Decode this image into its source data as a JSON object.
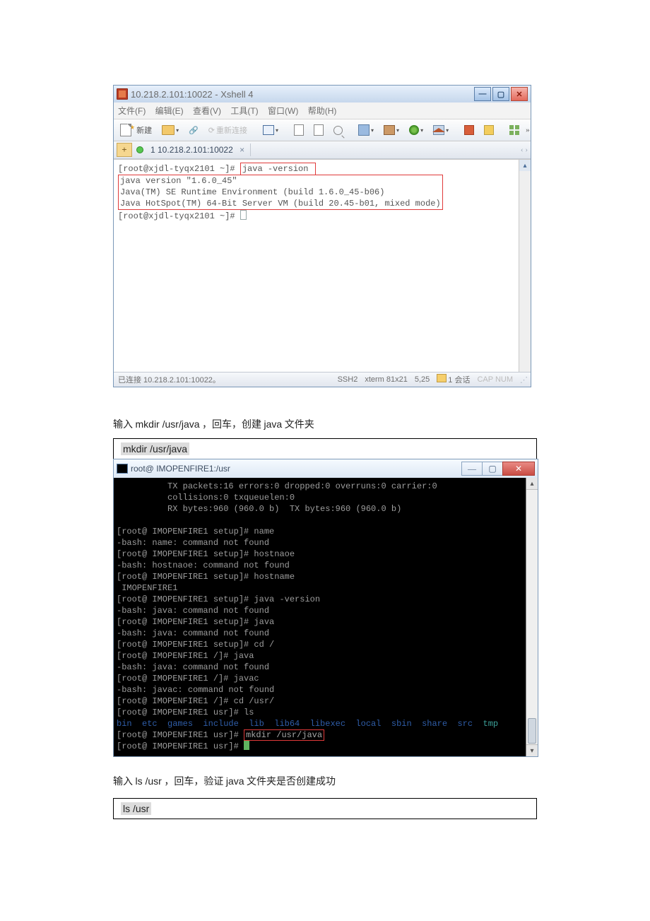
{
  "xshell": {
    "title": "10.218.2.101:10022 - Xshell 4",
    "menus": [
      "文件(F)",
      "编辑(E)",
      "查看(V)",
      "工具(T)",
      "窗口(W)",
      "帮助(H)"
    ],
    "toolbar": {
      "new_label": "新建",
      "reconnect_label": "重新连接"
    },
    "tab": {
      "label": "1 10.218.2.101:10022"
    },
    "terminal": {
      "prompt1": "[root@xjdl-tyqx2101 ~]#",
      "cmd1": "java -version",
      "out": [
        "java version \"1.6.0_45\"",
        "Java(TM) SE Runtime Environment (build 1.6.0_45-b06)",
        "Java HotSpot(TM) 64-Bit Server VM (build 20.45-b01, mixed mode)"
      ],
      "prompt2": "[root@xjdl-tyqx2101 ~]#"
    },
    "status": {
      "left": "已连接 10.218.2.101:10022。",
      "ssh": "SSH2",
      "term": "xterm  81x21",
      "pos": "5,25",
      "sess": "1 会话",
      "caps": "CAP  NUM"
    }
  },
  "text1_pre": "输入 ",
  "text1_cmd": "mkdir /usr/java",
  "text1_mid": "   ，回车，创建  ",
  "text1_j": "java",
  "text1_post": " 文件夹",
  "cmd1": "mkdir /usr/java",
  "darkwin": {
    "title": "root@ IMOPENFIRE1:/usr",
    "lines_top": [
      "          TX packets:16 errors:0 dropped:0 overruns:0 carrier:0",
      "          collisions:0 txqueuelen:0",
      "          RX bytes:960 (960.0 b)  TX bytes:960 (960.0 b)",
      ""
    ],
    "lines": [
      "[root@ IMOPENFIRE1 setup]# name",
      "-bash: name: command not found",
      "[root@ IMOPENFIRE1 setup]# hostnaoe",
      "-bash: hostnaoe: command not found",
      "[root@ IMOPENFIRE1 setup]# hostname",
      " IMOPENFIRE1",
      "[root@ IMOPENFIRE1 setup]# java -version",
      "-bash: java: command not found",
      "[root@ IMOPENFIRE1 setup]# java",
      "-bash: java: command not found",
      "[root@ IMOPENFIRE1 setup]# cd /",
      "[root@ IMOPENFIRE1 /]# java",
      "-bash: java: command not found",
      "[root@ IMOPENFIRE1 /]# javac",
      "-bash: javac: command not found",
      "[root@ IMOPENFIRE1 /]# cd /usr/",
      "[root@ IMOPENFIRE1 usr]# ls"
    ],
    "dirline_left": "bin  etc  games  include  lib  lib64  libexec  local  sbin  share  src",
    "dirline_tmp": "  tmp",
    "mkdir_prompt": "[root@ IMOPENFIRE1 usr]#",
    "mkdir_cmd": "mkdir /usr/java",
    "last_prompt": "[root@ IMOPENFIRE1 usr]# "
  },
  "text2_pre": "输入 ",
  "text2_cmd": "ls /usr",
  "text2_mid": "  ，回车，验证  ",
  "text2_j": "java",
  "text2_post": " 文件夹是否创建成功",
  "cmd2": "ls /usr"
}
